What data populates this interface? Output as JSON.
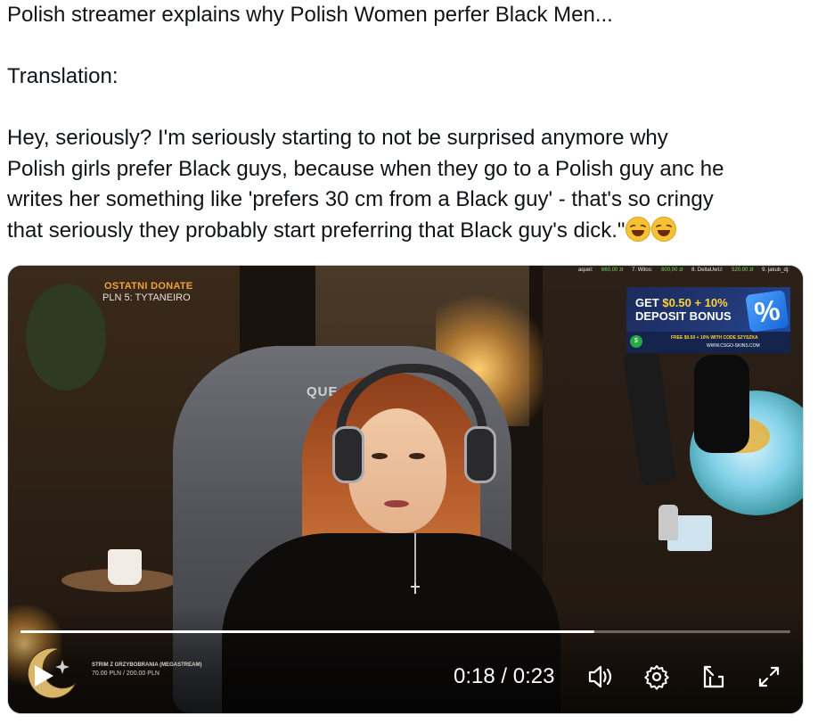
{
  "post": {
    "line1": "Polish streamer explains why Polish Women perfer Black Men...",
    "line2": "Translation:",
    "line3": "Hey, seriously? I'm seriously starting to not be surprised anymore why",
    "line4": "Polish girls prefer Black guys, because when they go to a Polish guy anc he",
    "line5": "writes her something like 'prefers 30 cm from a Black guy' - that's so cringy",
    "line6": "that seriously they probably start preferring that Black guy's dick.\"",
    "emojis": [
      "rolling-on-floor-laughing",
      "rolling-on-floor-laughing"
    ]
  },
  "video": {
    "overlay": {
      "donate_title": "OSTATNI DONATE",
      "donate_sub": "PLN 5: TYTANEIRO",
      "chair_brand": "QUE",
      "ticker": [
        {
          "label": "aquel:",
          "value": "660,00 zł"
        },
        {
          "label": "7. Witos:",
          "value": "600,00 zł"
        },
        {
          "label": "8. DeltaUwU:",
          "value": "520,00 zł"
        },
        {
          "label": "9. jakub_dj:",
          "value": ""
        }
      ],
      "ad": {
        "line1_prefix": "GET ",
        "line1_highlight": "$0.50 + 10%",
        "line2": "DEPOSIT BONUS",
        "percent": "%",
        "line3": "FREE $0.50 + 10% WITH CODE SZYSZKA",
        "line4": "WWW.CSGO-SKINS.COM"
      },
      "strim_name": "STRIM Z GRZYBOBRANIA (MEGASTREAM)",
      "strim_amount": "70.00 PLN / 200.00 PLN"
    },
    "controls": {
      "time": "0:18 / 0:23",
      "progress_fraction": 0.745
    }
  }
}
